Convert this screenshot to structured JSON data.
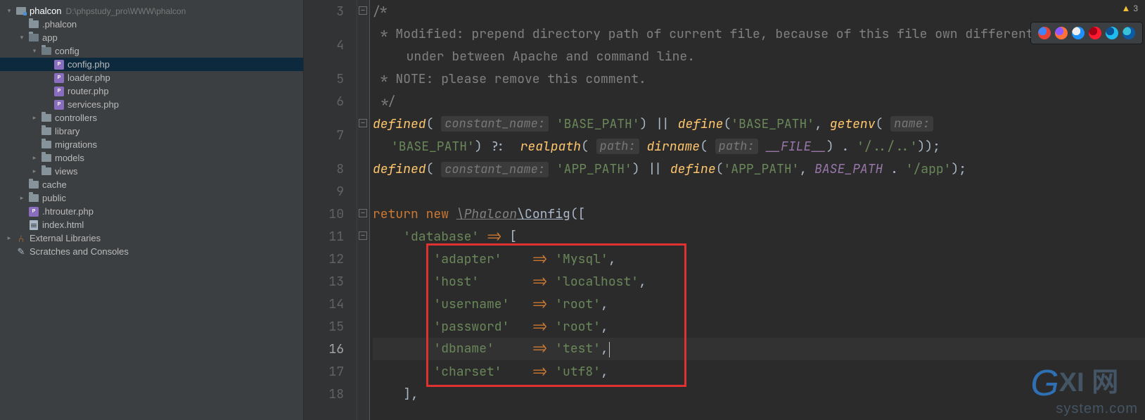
{
  "project": {
    "root": {
      "name": "phalcon",
      "path": "D:\\phpstudy_pro\\WWW\\phalcon"
    },
    "tree": [
      {
        "depth": 0,
        "arrow": "down",
        "icon": "module",
        "label": "phalcon",
        "path": "D:\\phpstudy_pro\\WWW\\phalcon",
        "root": true
      },
      {
        "depth": 1,
        "arrow": "",
        "icon": "folder",
        "label": ".phalcon"
      },
      {
        "depth": 1,
        "arrow": "down",
        "icon": "folder-open",
        "label": "app"
      },
      {
        "depth": 2,
        "arrow": "down",
        "icon": "folder-open",
        "label": "config"
      },
      {
        "depth": 3,
        "arrow": "",
        "icon": "php",
        "label": "config.php",
        "selected": true
      },
      {
        "depth": 3,
        "arrow": "",
        "icon": "php",
        "label": "loader.php"
      },
      {
        "depth": 3,
        "arrow": "",
        "icon": "php",
        "label": "router.php"
      },
      {
        "depth": 3,
        "arrow": "",
        "icon": "php",
        "label": "services.php"
      },
      {
        "depth": 2,
        "arrow": "right",
        "icon": "folder",
        "label": "controllers"
      },
      {
        "depth": 2,
        "arrow": "",
        "icon": "folder",
        "label": "library"
      },
      {
        "depth": 2,
        "arrow": "",
        "icon": "folder",
        "label": "migrations"
      },
      {
        "depth": 2,
        "arrow": "right",
        "icon": "folder",
        "label": "models"
      },
      {
        "depth": 2,
        "arrow": "right",
        "icon": "folder",
        "label": "views"
      },
      {
        "depth": 1,
        "arrow": "",
        "icon": "folder",
        "label": "cache"
      },
      {
        "depth": 1,
        "arrow": "right",
        "icon": "folder",
        "label": "public"
      },
      {
        "depth": 1,
        "arrow": "",
        "icon": "php",
        "label": ".htrouter.php"
      },
      {
        "depth": 1,
        "arrow": "",
        "icon": "html",
        "label": "index.html"
      },
      {
        "depth": 0,
        "arrow": "right",
        "icon": "lib",
        "label": "External Libraries"
      },
      {
        "depth": 0,
        "arrow": "",
        "icon": "scratch",
        "label": "Scratches and Consoles"
      }
    ]
  },
  "editor": {
    "warning_count": "3",
    "current_line": 16,
    "lines": [
      {
        "n": 3,
        "tokens": [
          [
            "comment",
            "/*"
          ]
        ]
      },
      {
        "n": 4,
        "tokens": [
          [
            "comment",
            " * Modified: prepend directory path of current file, because of this file own different ENV"
          ],
          [
            "comment",
            "  under between Apache and command line."
          ]
        ],
        "wrap": true
      },
      {
        "n": 5,
        "tokens": [
          [
            "comment",
            " * NOTE: please remove this comment."
          ]
        ]
      },
      {
        "n": 6,
        "tokens": [
          [
            "comment",
            " */"
          ]
        ]
      },
      {
        "n": 7,
        "tokens": [
          [
            "func",
            "defined"
          ],
          [
            "plain",
            "( "
          ],
          [
            "hint",
            "constant_name:"
          ],
          [
            "plain",
            " "
          ],
          [
            "string",
            "'BASE_PATH'"
          ],
          [
            "plain",
            ") || "
          ],
          [
            "func",
            "define"
          ],
          [
            "plain",
            "("
          ],
          [
            "string",
            "'BASE_PATH'"
          ],
          [
            "plain",
            ", "
          ],
          [
            "func",
            "getenv"
          ],
          [
            "plain",
            "( "
          ],
          [
            "hint",
            "name:"
          ],
          [
            "plain",
            " "
          ],
          [
            "string",
            "'BASE_PATH'"
          ],
          [
            "plain",
            ") ?:  "
          ],
          [
            "func",
            "realpath"
          ],
          [
            "plain",
            "( "
          ],
          [
            "hint",
            "path:"
          ],
          [
            "plain",
            " "
          ],
          [
            "func",
            "dirname"
          ],
          [
            "plain",
            "( "
          ],
          [
            "hint",
            "path:"
          ],
          [
            "plain",
            " "
          ],
          [
            "const",
            "__FILE__"
          ],
          [
            "plain",
            ") . "
          ],
          [
            "string",
            "'/../..'"
          ],
          [
            "plain",
            "));"
          ]
        ],
        "wrap": true
      },
      {
        "n": 8,
        "tokens": [
          [
            "func",
            "defined"
          ],
          [
            "plain",
            "( "
          ],
          [
            "hint",
            "constant_name:"
          ],
          [
            "plain",
            " "
          ],
          [
            "string",
            "'APP_PATH'"
          ],
          [
            "plain",
            ") || "
          ],
          [
            "func",
            "define"
          ],
          [
            "plain",
            "("
          ],
          [
            "string",
            "'APP_PATH'"
          ],
          [
            "plain",
            ", "
          ],
          [
            "const",
            "BASE_PATH"
          ],
          [
            "plain",
            " . "
          ],
          [
            "string",
            "'/app'"
          ],
          [
            "plain",
            ");"
          ]
        ]
      },
      {
        "n": 9,
        "tokens": []
      },
      {
        "n": 10,
        "tokens": [
          [
            "kw2",
            "return new "
          ],
          [
            "nsit",
            "\\Phalcon"
          ],
          [
            "ns",
            "\\"
          ],
          [
            "ns",
            "Config"
          ],
          [
            "plain",
            "(["
          ]
        ]
      },
      {
        "n": 11,
        "tokens": [
          [
            "plain",
            "    "
          ],
          [
            "string",
            "'database'"
          ],
          [
            "plain",
            " "
          ],
          [
            "arrow",
            "=>"
          ],
          [
            "plain",
            " ["
          ]
        ]
      },
      {
        "n": 12,
        "tokens": [
          [
            "plain",
            "        "
          ],
          [
            "string",
            "'adapter'"
          ],
          [
            "plain",
            "    "
          ],
          [
            "arrow",
            "=>"
          ],
          [
            "plain",
            " "
          ],
          [
            "string",
            "'Mysql'"
          ],
          [
            "plain",
            ","
          ]
        ]
      },
      {
        "n": 13,
        "tokens": [
          [
            "plain",
            "        "
          ],
          [
            "string",
            "'host'"
          ],
          [
            "plain",
            "       "
          ],
          [
            "arrow",
            "=>"
          ],
          [
            "plain",
            " "
          ],
          [
            "string",
            "'localhost'"
          ],
          [
            "plain",
            ","
          ]
        ]
      },
      {
        "n": 14,
        "tokens": [
          [
            "plain",
            "        "
          ],
          [
            "string",
            "'username'"
          ],
          [
            "plain",
            "   "
          ],
          [
            "arrow",
            "=>"
          ],
          [
            "plain",
            " "
          ],
          [
            "string",
            "'root'"
          ],
          [
            "plain",
            ","
          ]
        ]
      },
      {
        "n": 15,
        "tokens": [
          [
            "plain",
            "        "
          ],
          [
            "string",
            "'password'"
          ],
          [
            "plain",
            "   "
          ],
          [
            "arrow",
            "=>"
          ],
          [
            "plain",
            " "
          ],
          [
            "string",
            "'root'"
          ],
          [
            "plain",
            ","
          ]
        ]
      },
      {
        "n": 16,
        "tokens": [
          [
            "plain",
            "        "
          ],
          [
            "string",
            "'dbname'"
          ],
          [
            "plain",
            "     "
          ],
          [
            "arrow",
            "=>"
          ],
          [
            "plain",
            " "
          ],
          [
            "string",
            "'test'"
          ],
          [
            "plain",
            ","
          ]
        ],
        "caret": true
      },
      {
        "n": 17,
        "tokens": [
          [
            "plain",
            "        "
          ],
          [
            "string",
            "'charset'"
          ],
          [
            "plain",
            "    "
          ],
          [
            "arrow",
            "=>"
          ],
          [
            "plain",
            " "
          ],
          [
            "string",
            "'utf8'"
          ],
          [
            "plain",
            ","
          ]
        ]
      },
      {
        "n": 18,
        "tokens": [
          [
            "plain",
            "    ],"
          ]
        ]
      }
    ]
  },
  "browser_icons": [
    {
      "name": "chrome",
      "color1": "#ea4335",
      "color2": "#4285f4"
    },
    {
      "name": "firefox",
      "color1": "#ff7139",
      "color2": "#9059ff"
    },
    {
      "name": "safari",
      "color1": "#1e90ff",
      "color2": "#eeeeee"
    },
    {
      "name": "opera",
      "color1": "#ff1b2d",
      "color2": "#a60014"
    },
    {
      "name": "ie",
      "color1": "#1ebbee",
      "color2": "#0b5394"
    },
    {
      "name": "edge",
      "color1": "#0c59a4",
      "color2": "#39c1d7"
    }
  ],
  "watermark": {
    "big": "XI 网",
    "sub": "system.com",
    "g": "G"
  }
}
